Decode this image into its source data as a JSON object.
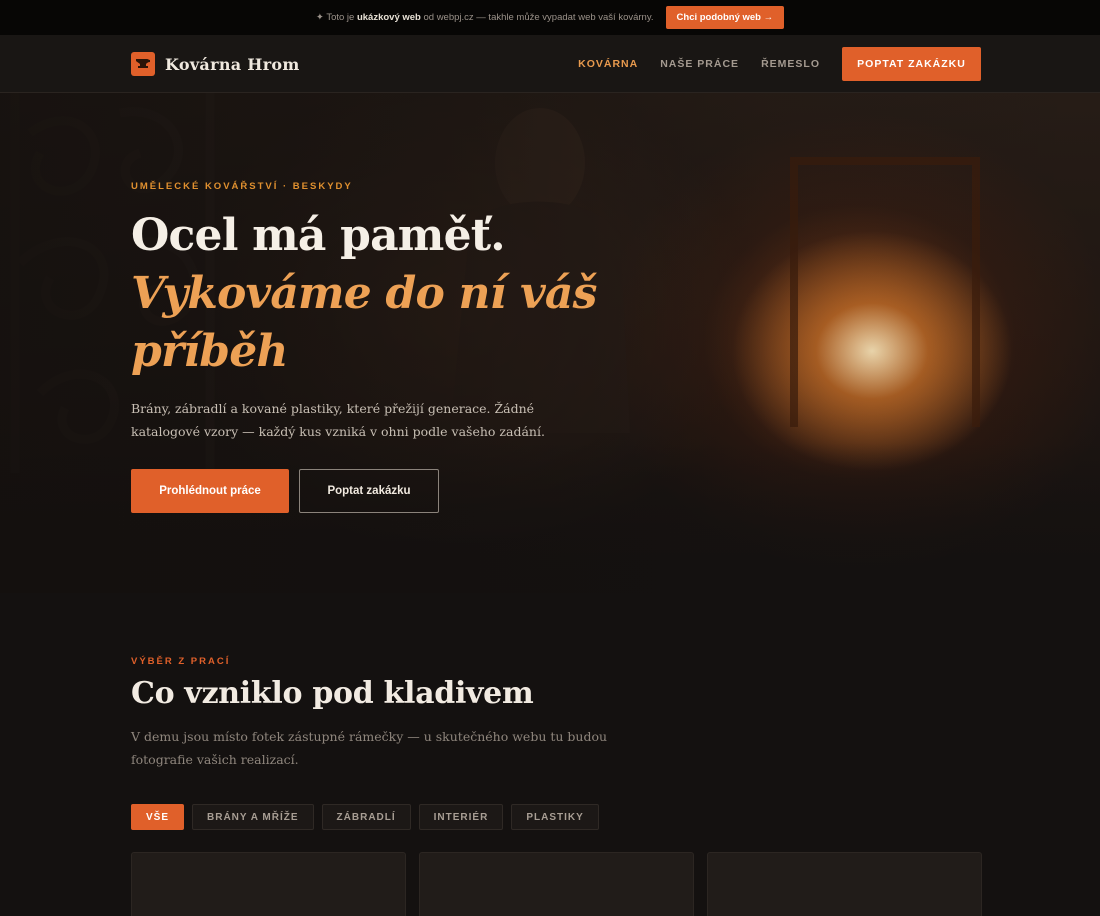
{
  "promo": {
    "star": "✦",
    "text_before": "Toto je",
    "text_bold": "ukázkový web",
    "text_after": "od webpj.cz — takhle může vypadat web vaší kovárny.",
    "button": "Chci podobný web →"
  },
  "header": {
    "brand": "Kovárna Hrom",
    "nav": [
      "KOVÁRNA",
      "NAŠE PRÁCE",
      "ŘEMESLO"
    ],
    "cta": "POPTAT ZAKÁZKU"
  },
  "hero": {
    "eyebrow": "UMĚLECKÉ KOVÁŘSTVÍ · BESKYDY",
    "title_line1": "Ocel má paměť.",
    "title_accent": "Vykováme do ní váš příběh",
    "lead": "Brány, zábradlí a kované plastiky, které přežijí generace. Žádné katalogové vzory — každý kus vzniká v ohni podle vašeho zadání.",
    "btn_primary": "Prohlédnout práce",
    "btn_secondary": "Poptat zakázku"
  },
  "works": {
    "eyebrow": "VÝBĚR Z PRACÍ",
    "title": "Co vzniklo pod kladivem",
    "lead": "V demu jsou místo fotek zástupné rámečky — u skutečného webu tu budou fotografie vašich realizací.",
    "filters": [
      "VŠE",
      "BRÁNY A MŘÍŽE",
      "ZÁBRADLÍ",
      "INTERIÉR",
      "PLASTIKY"
    ]
  },
  "colors": {
    "accent": "#e0602a",
    "accent_light": "#eda155",
    "background": "#141110"
  }
}
